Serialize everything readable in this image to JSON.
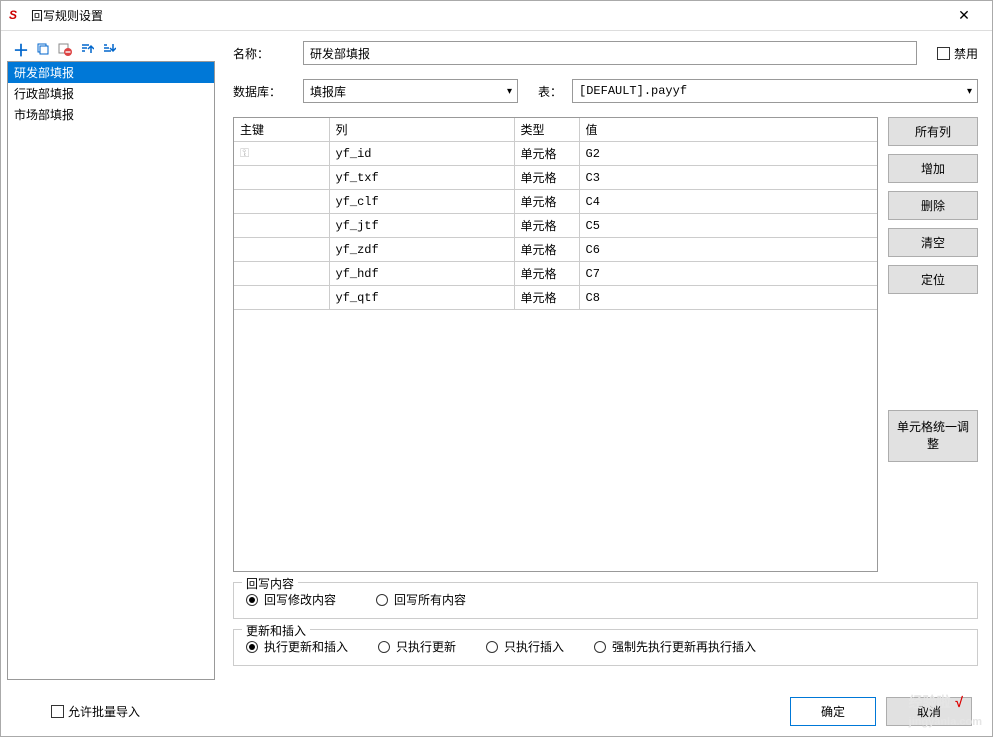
{
  "window": {
    "title": "回写规则设置"
  },
  "toolbar": {
    "add": "＋",
    "copy": "⧉",
    "delete": "⊟",
    "up": "↑",
    "down": "↓"
  },
  "sidebar": {
    "items": [
      {
        "label": "研发部填报",
        "selected": true
      },
      {
        "label": "行政部填报",
        "selected": false
      },
      {
        "label": "市场部填报",
        "selected": false
      }
    ]
  },
  "form": {
    "name_label": "名称：",
    "name_value": "研发部填报",
    "disabled_label": "禁用",
    "db_label": "数据库：",
    "db_value": "填报库",
    "table_label": "表：",
    "table_value": "[DEFAULT].payyf"
  },
  "table": {
    "headers": [
      "主键",
      "列",
      "类型",
      "值"
    ],
    "rows": [
      {
        "key": true,
        "col": "yf_id",
        "type": "单元格",
        "val": "G2"
      },
      {
        "key": false,
        "col": "yf_txf",
        "type": "单元格",
        "val": "C3"
      },
      {
        "key": false,
        "col": "yf_clf",
        "type": "单元格",
        "val": "C4"
      },
      {
        "key": false,
        "col": "yf_jtf",
        "type": "单元格",
        "val": "C5"
      },
      {
        "key": false,
        "col": "yf_zdf",
        "type": "单元格",
        "val": "C6"
      },
      {
        "key": false,
        "col": "yf_hdf",
        "type": "单元格",
        "val": "C7"
      },
      {
        "key": false,
        "col": "yf_qtf",
        "type": "单元格",
        "val": "C8"
      }
    ]
  },
  "buttons": {
    "all_cols": "所有列",
    "add": "增加",
    "delete": "删除",
    "clear": "清空",
    "locate": "定位",
    "cell_adjust": "单元格统一调整"
  },
  "writeback": {
    "legend": "回写内容",
    "opt1": "回写修改内容",
    "opt2": "回写所有内容"
  },
  "update_insert": {
    "legend": "更新和插入",
    "opt1": "执行更新和插入",
    "opt2": "只执行更新",
    "opt3": "只执行插入",
    "opt4": "强制先执行更新再执行插入"
  },
  "footer": {
    "batch_import": "允许批量导入",
    "ok": "确定",
    "cancel": "取消"
  },
  "watermark": {
    "text": "经验啦",
    "check": "√",
    "url": "jingyanla.com"
  }
}
